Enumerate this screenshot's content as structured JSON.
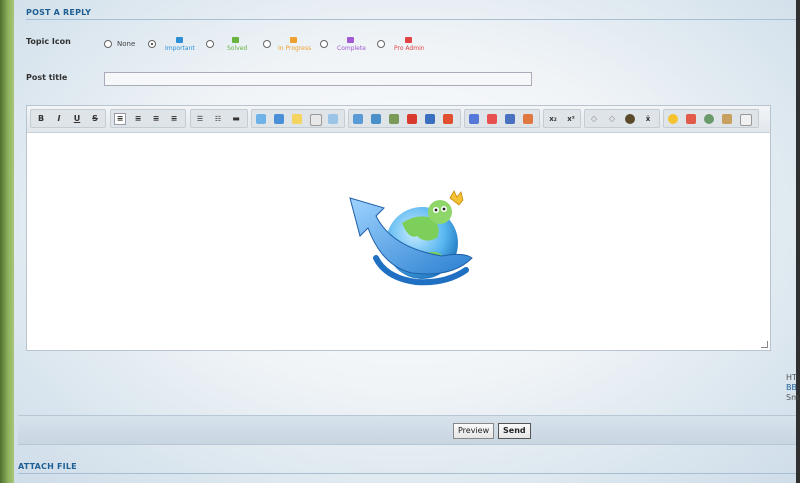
{
  "reply_section": {
    "heading": "POST A REPLY"
  },
  "topic_icon": {
    "label": "Topic Icon",
    "options": [
      {
        "name": "None",
        "color": ""
      },
      {
        "name": "Important",
        "color": "#2d8fd5",
        "selected": true
      },
      {
        "name": "Solved",
        "color": "#69b33f"
      },
      {
        "name": "In Progress",
        "color": "#f0a030"
      },
      {
        "name": "Complete",
        "color": "#a05ad2"
      },
      {
        "name": "Pro Admin",
        "color": "#e04545"
      }
    ]
  },
  "post_title": {
    "label": "Post title",
    "value": ""
  },
  "editor": {
    "toolbar": {
      "bold": "B",
      "italic": "I",
      "underline": "U",
      "strike": "S",
      "subscript": "x₂",
      "superscript": "x²",
      "icons": [
        "align-left-icon",
        "align-center-icon",
        "align-right-icon",
        "justify-icon",
        "bullet-list-icon",
        "numbered-list-icon",
        "horizontal-rule-icon",
        "quote-icon",
        "code-icon",
        "spoiler-icon",
        "pagebreak-icon",
        "table-icon",
        "image-icon",
        "image-upload-icon",
        "link-icon",
        "youtube-icon",
        "video-icon",
        "flash-icon",
        "font-icon",
        "font-color-icon",
        "font-size-icon",
        "font-bg-icon",
        "undo-icon",
        "redo-icon",
        "maximize-icon",
        "special-char-icon",
        "emoticon-icon",
        "date-icon",
        "find-icon",
        "paste-icon",
        "source-icon"
      ]
    }
  },
  "side": {
    "line1": "HT",
    "line2": "BB",
    "line3": "Sm"
  },
  "actions": {
    "preview_label": "Preview",
    "send_label": "Send"
  },
  "attach_section": {
    "heading": "ATTACH FILE"
  },
  "colors": {
    "accent": "#1f5e93",
    "edge": "#8fb45e"
  }
}
